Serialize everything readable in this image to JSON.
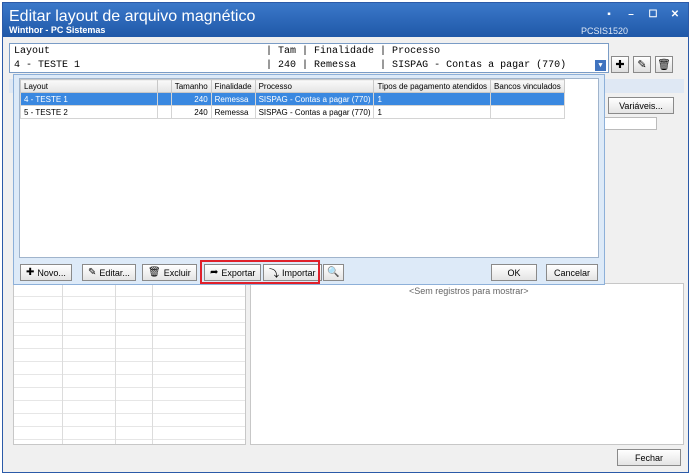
{
  "window": {
    "title": "Editar layout de arquivo magnético",
    "subtitle": "Winthor - PC Sistemas",
    "code": "PCSIS1520",
    "controls": [
      "minimize-icon",
      "maximize-icon",
      "close-icon"
    ]
  },
  "layout_combo": {
    "header": "Layout                                    | Tam | Finalidade | Processo",
    "value": "4 - TESTE 1                               | 240 | Remessa    | SISPAG - Contas a pagar (770)"
  },
  "toolbar": {
    "add_icon": "plus-icon",
    "edit_icon": "pencil-icon",
    "delete_icon": "trash-icon"
  },
  "side": {
    "variables_label": "Variáveis...",
    "empty_message": "<Sem registros para mostrar>",
    "close_label": "Fechar"
  },
  "popup": {
    "columns": [
      "Layout",
      "",
      "Tamanho",
      "Finalidade",
      "Processo",
      "Tipos de pagamento atendidos",
      "Bancos vinculados"
    ],
    "rows": [
      {
        "layout": "4 - TESTE 1",
        "blank": "",
        "tamanho": "240",
        "finalidade": "Remessa",
        "processo": "SISPAG - Contas a pagar (770)",
        "tipos": "1",
        "bancos": ""
      },
      {
        "layout": "5 - TESTE 2",
        "blank": "",
        "tamanho": "240",
        "finalidade": "Remessa",
        "processo": "SISPAG - Contas a pagar (770)",
        "tipos": "1",
        "bancos": ""
      }
    ],
    "buttons": {
      "novo": "Novo...",
      "editar": "Editar...",
      "excluir": "Excluir",
      "exportar": "Exportar",
      "importar": "Importar",
      "ok": "OK",
      "cancelar": "Cancelar"
    }
  },
  "colors": {
    "titlebar": "#1f58a8",
    "selection": "#3a88e0",
    "highlight": "#e0202a"
  }
}
